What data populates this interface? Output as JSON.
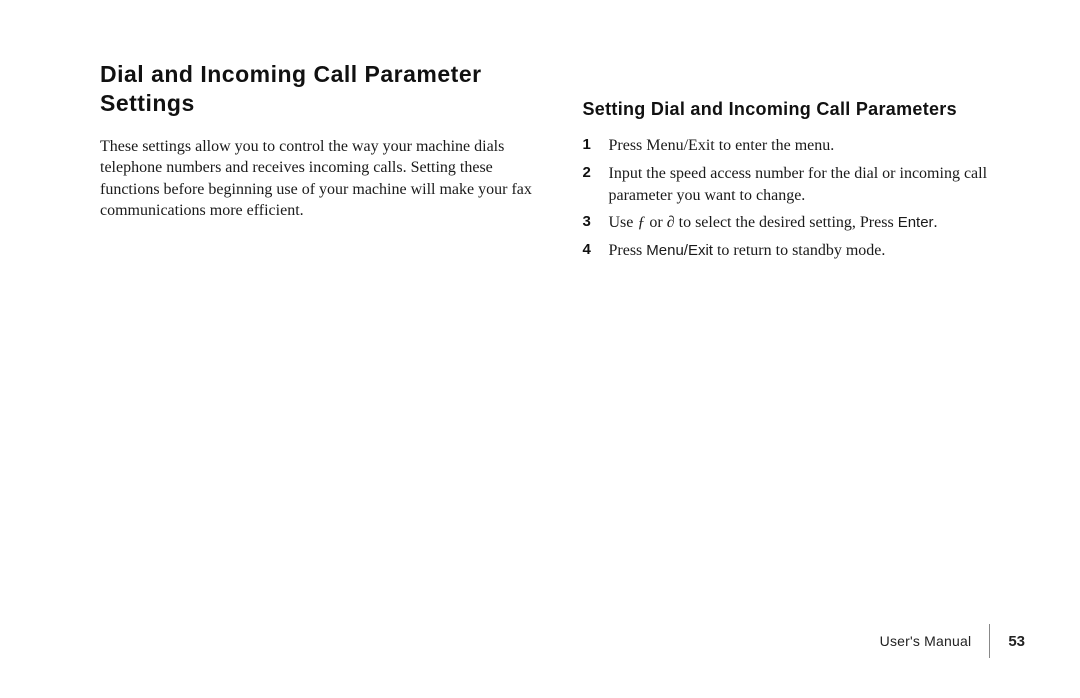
{
  "left": {
    "title_prefix": "D",
    "title_rest": "ial and Incoming Call Parameter Settings",
    "paragraph": "These settings allow you to control the way your machine dials telephone numbers and receives incoming calls. Setting these functions before beginning use of your machine will make your fax communications more efficient."
  },
  "right": {
    "subtitle_prefix": "Setting ",
    "subtitle_d": "D",
    "subtitle_rest": "ial and Incoming Call Parameters",
    "steps": {
      "s1": {
        "num": "1",
        "text": "Press Menu/Exit to enter the menu."
      },
      "s2": {
        "num": "2",
        "text": "Input the speed access number for the dial or incoming call parameter you want to change."
      },
      "s3": {
        "num": "3",
        "pre": "Use ",
        "sym1": "ƒ",
        "mid": " or ",
        "sym2": "∂",
        "post": " to select the desired setting,  Press ",
        "enter": "Enter",
        "period": "."
      },
      "s4": {
        "num": "4",
        "pre": "Press ",
        "btn": "Menu/Exit",
        "post": " to return to standby mode."
      }
    }
  },
  "footer": {
    "label_pre": "User's ",
    "label_m": "M",
    "label_post": "anual",
    "page": "53"
  }
}
